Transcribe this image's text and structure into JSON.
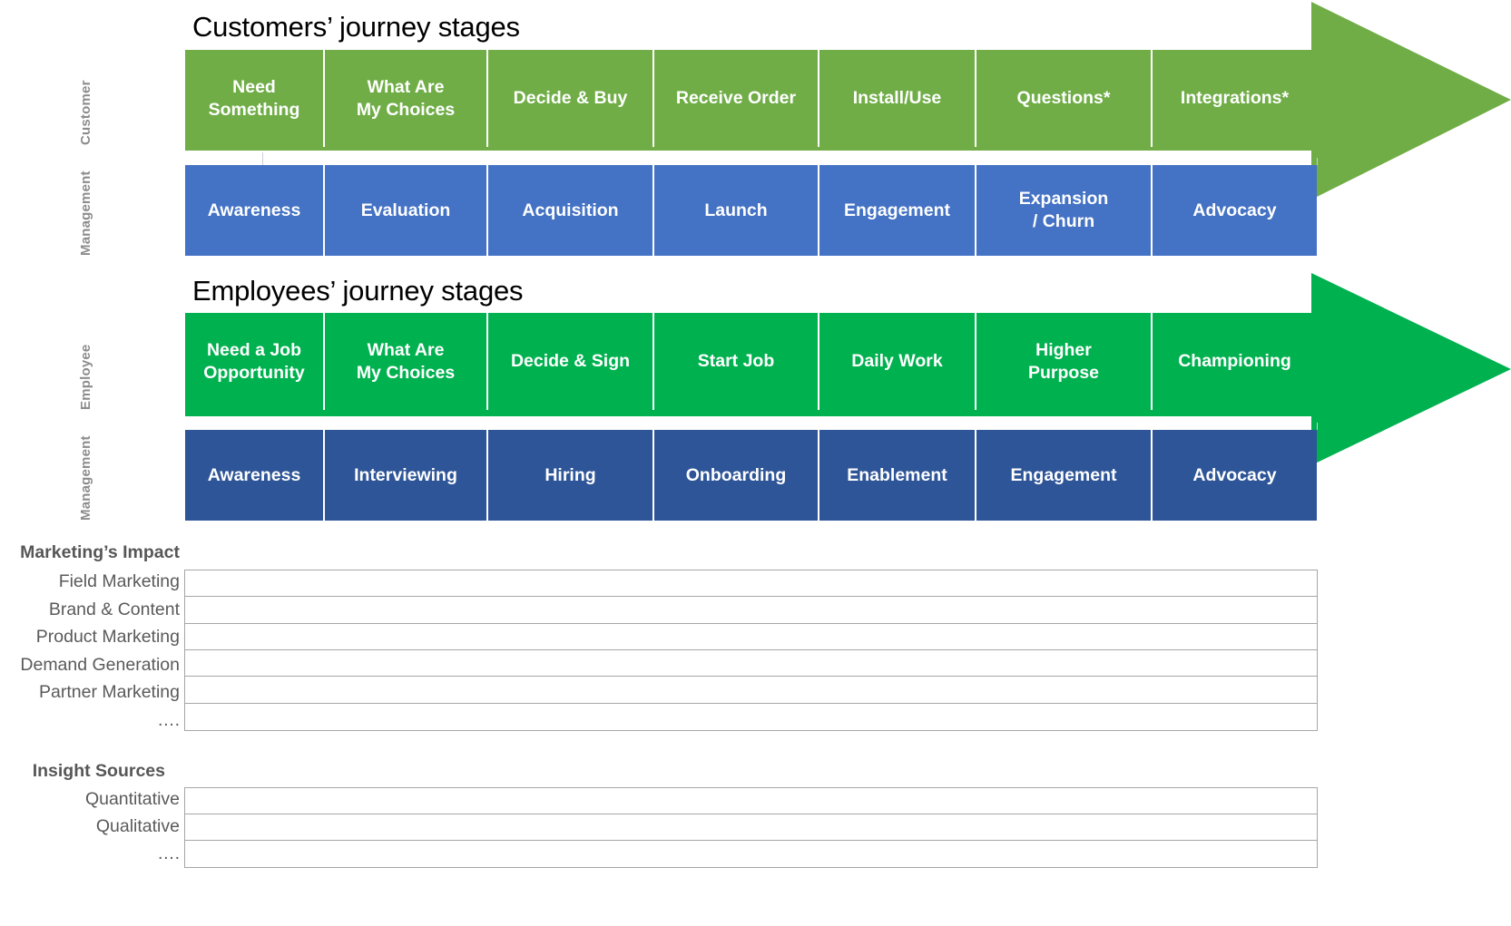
{
  "customer_journey": {
    "title": "Customers’ journey stages",
    "row_labels": {
      "top": "Customer",
      "bottom": "Management"
    },
    "arrow_color": "#70AD47",
    "stage_color": "#70AD47",
    "management_color": "#4472C4",
    "stages": [
      "Need\nSomething",
      "What Are\nMy Choices",
      "Decide & Buy",
      "Receive Order",
      "Install/Use",
      "Questions*",
      "Integrations*"
    ],
    "management": [
      "Awareness",
      "Evaluation",
      "Acquisition",
      "Launch",
      "Engagement",
      "Expansion\n/ Churn",
      "Advocacy"
    ]
  },
  "employee_journey": {
    "title": "Employees’ journey stages",
    "row_labels": {
      "top": "Employee",
      "bottom": "Management"
    },
    "arrow_color": "#00B14F",
    "stage_color": "#00B14F",
    "management_color": "#2E5597",
    "stages": [
      "Need a Job\nOpportunity",
      "What Are\nMy Choices",
      "Decide & Sign",
      "Start Job",
      "Daily Work",
      "Higher\nPurpose",
      "Championing"
    ],
    "management": [
      "Awareness",
      "Interviewing",
      "Hiring",
      "Onboarding",
      "Enablement",
      "Engagement",
      "Advocacy"
    ]
  },
  "marketing_impact": {
    "heading": "Marketing’s Impact",
    "rows": [
      "Field Marketing",
      "Brand & Content",
      "Product Marketing",
      "Demand Generation",
      "Partner Marketing",
      "…."
    ]
  },
  "insight_sources": {
    "heading": "Insight Sources",
    "rows": [
      "Quantitative",
      "Qualitative",
      "…."
    ]
  }
}
